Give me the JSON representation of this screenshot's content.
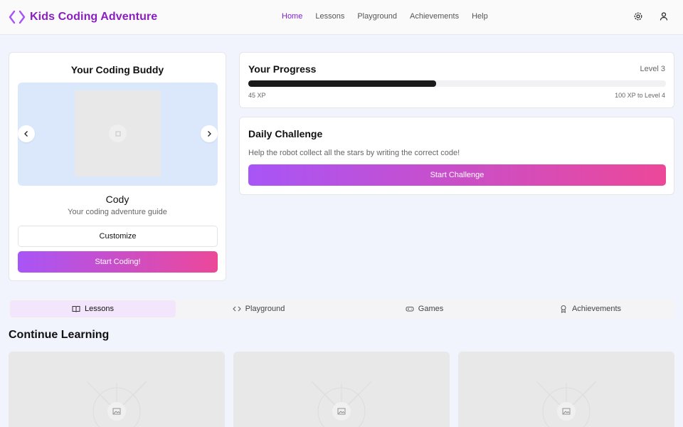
{
  "app": {
    "title": "Kids Coding Adventure"
  },
  "nav": [
    {
      "label": "Home",
      "active": true
    },
    {
      "label": "Lessons"
    },
    {
      "label": "Playground"
    },
    {
      "label": "Achievements"
    },
    {
      "label": "Help"
    }
  ],
  "buddy": {
    "title": "Your Coding Buddy",
    "name": "Cody",
    "description": "Your coding adventure guide",
    "customize_label": "Customize",
    "start_label": "Start Coding!"
  },
  "progress": {
    "title": "Your Progress",
    "level": "Level 3",
    "xp": "45 XP",
    "next": "100 XP to Level 4",
    "fraction": 0.45
  },
  "daily": {
    "title": "Daily Challenge",
    "description": "Help the robot collect all the stars by writing the correct code!",
    "button_label": "Start Challenge"
  },
  "tabs": [
    {
      "label": "Lessons",
      "icon": "book-icon",
      "active": true
    },
    {
      "label": "Playground",
      "icon": "code-icon"
    },
    {
      "label": "Games",
      "icon": "gamepad-icon"
    },
    {
      "label": "Achievements",
      "icon": "award-icon"
    }
  ],
  "continue_learning": {
    "title": "Continue Learning"
  },
  "colors": {
    "brand": "#8a1fc0",
    "accent_start": "#a855f7",
    "accent_end": "#ec4899"
  }
}
